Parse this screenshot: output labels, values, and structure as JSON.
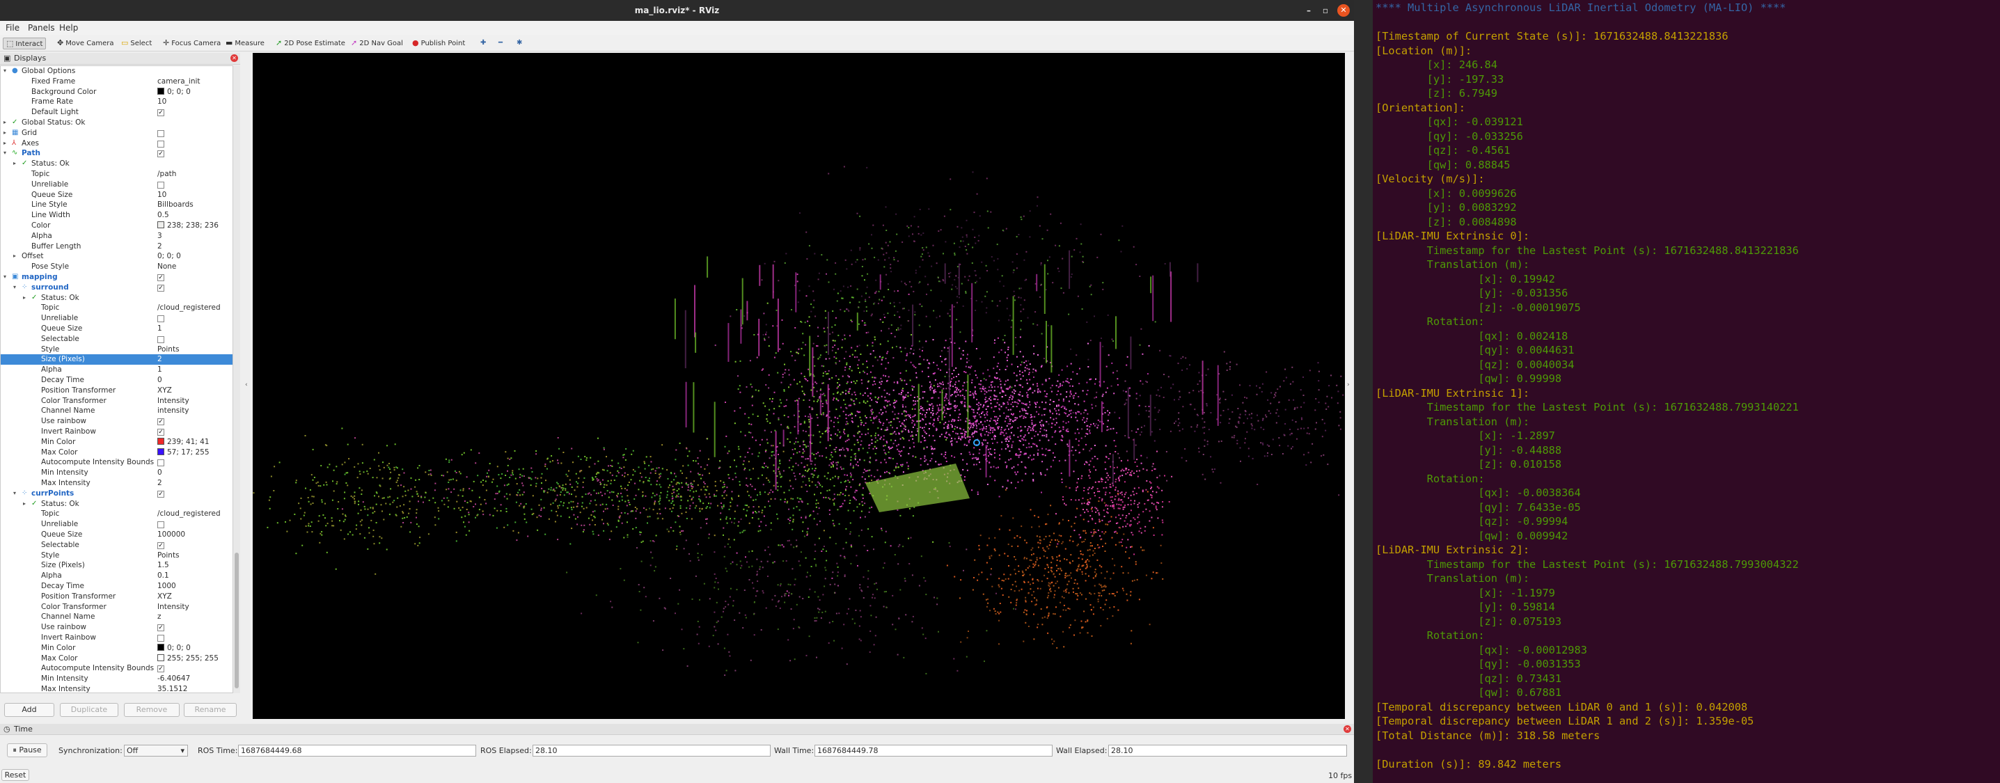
{
  "window": {
    "title": "ma_lio.rviz* - RViz"
  },
  "menu": [
    "File",
    "Panels",
    "Help"
  ],
  "toolbar": [
    "Interact",
    "Move Camera",
    "Select",
    "Focus Camera",
    "Measure",
    "2D Pose Estimate",
    "2D Nav Goal",
    "Publish Point"
  ],
  "displays": {
    "title": "Displays",
    "rows": [
      {
        "name": "Global Options",
        "value": "",
        "indent": 0,
        "exp": "open",
        "icon": "globe",
        "cls": ""
      },
      {
        "name": "Fixed Frame",
        "value": "camera_init",
        "indent": 2
      },
      {
        "name": "Background Color",
        "value": "0; 0; 0",
        "indent": 2,
        "swatch": "#000000"
      },
      {
        "name": "Frame Rate",
        "value": "10",
        "indent": 2
      },
      {
        "name": "Default Light",
        "value": "",
        "indent": 2,
        "check": "✓"
      },
      {
        "name": "Global Status: Ok",
        "value": "",
        "indent": 0,
        "exp": "closed",
        "icon": "ok"
      },
      {
        "name": "Grid",
        "value": "",
        "indent": 0,
        "exp": "closed",
        "icon": "grid",
        "check": ""
      },
      {
        "name": "Axes",
        "value": "",
        "indent": 0,
        "exp": "closed",
        "icon": "axes",
        "check": ""
      },
      {
        "name": "Path",
        "value": "",
        "indent": 0,
        "exp": "open",
        "icon": "path",
        "cls": "blue",
        "check": "✓"
      },
      {
        "name": "Status: Ok",
        "value": "",
        "indent": 1,
        "exp": "closed",
        "icon": "ok"
      },
      {
        "name": "Topic",
        "value": "/path",
        "indent": 2
      },
      {
        "name": "Unreliable",
        "value": "",
        "indent": 2,
        "check": ""
      },
      {
        "name": "Queue Size",
        "value": "10",
        "indent": 2
      },
      {
        "name": "Line Style",
        "value": "Billboards",
        "indent": 2
      },
      {
        "name": "Line Width",
        "value": "0.5",
        "indent": 2
      },
      {
        "name": "Color",
        "value": "238; 238; 236",
        "indent": 2,
        "swatch": "#eeeeec"
      },
      {
        "name": "Alpha",
        "value": "3",
        "indent": 2
      },
      {
        "name": "Buffer Length",
        "value": "2",
        "indent": 2
      },
      {
        "name": "Offset",
        "value": "0; 0; 0",
        "indent": 1,
        "exp": "closed"
      },
      {
        "name": "Pose Style",
        "value": "None",
        "indent": 2
      },
      {
        "name": "mapping",
        "value": "",
        "indent": 0,
        "exp": "open",
        "icon": "folder",
        "cls": "blue",
        "check": "✓"
      },
      {
        "name": "surround",
        "value": "",
        "indent": 1,
        "exp": "open",
        "icon": "cloud",
        "cls": "blue",
        "check": "✓"
      },
      {
        "name": "Status: Ok",
        "value": "",
        "indent": 2,
        "exp": "closed",
        "icon": "ok"
      },
      {
        "name": "Topic",
        "value": "/cloud_registered",
        "indent": 3
      },
      {
        "name": "Unreliable",
        "value": "",
        "indent": 3,
        "check": ""
      },
      {
        "name": "Queue Size",
        "value": "1",
        "indent": 3
      },
      {
        "name": "Selectable",
        "value": "",
        "indent": 3,
        "check": ""
      },
      {
        "name": "Style",
        "value": "Points",
        "indent": 3
      },
      {
        "name": "Size (Pixels)",
        "value": "2",
        "indent": 3,
        "selected": true
      },
      {
        "name": "Alpha",
        "value": "1",
        "indent": 3
      },
      {
        "name": "Decay Time",
        "value": "0",
        "indent": 3
      },
      {
        "name": "Position Transformer",
        "value": "XYZ",
        "indent": 3
      },
      {
        "name": "Color Transformer",
        "value": "Intensity",
        "indent": 3
      },
      {
        "name": "Channel Name",
        "value": "intensity",
        "indent": 3
      },
      {
        "name": "Use rainbow",
        "value": "",
        "indent": 3,
        "check": "✓"
      },
      {
        "name": "Invert Rainbow",
        "value": "",
        "indent": 3,
        "check": "✓"
      },
      {
        "name": "Min Color",
        "value": "239; 41; 41",
        "indent": 3,
        "swatch": "#ef2929"
      },
      {
        "name": "Max Color",
        "value": "57; 17; 255",
        "indent": 3,
        "swatch": "#3911ff"
      },
      {
        "name": "Autocompute Intensity Bounds",
        "value": "",
        "indent": 3,
        "check": ""
      },
      {
        "name": "Min Intensity",
        "value": "0",
        "indent": 3
      },
      {
        "name": "Max Intensity",
        "value": "2",
        "indent": 3
      },
      {
        "name": "currPoints",
        "value": "",
        "indent": 1,
        "exp": "open",
        "icon": "cloud",
        "cls": "blue",
        "check": "✓"
      },
      {
        "name": "Status: Ok",
        "value": "",
        "indent": 2,
        "exp": "closed",
        "icon": "ok"
      },
      {
        "name": "Topic",
        "value": "/cloud_registered",
        "indent": 3
      },
      {
        "name": "Unreliable",
        "value": "",
        "indent": 3,
        "check": ""
      },
      {
        "name": "Queue Size",
        "value": "100000",
        "indent": 3
      },
      {
        "name": "Selectable",
        "value": "",
        "indent": 3,
        "check": "✓"
      },
      {
        "name": "Style",
        "value": "Points",
        "indent": 3
      },
      {
        "name": "Size (Pixels)",
        "value": "1.5",
        "indent": 3
      },
      {
        "name": "Alpha",
        "value": "0.1",
        "indent": 3
      },
      {
        "name": "Decay Time",
        "value": "1000",
        "indent": 3
      },
      {
        "name": "Position Transformer",
        "value": "XYZ",
        "indent": 3
      },
      {
        "name": "Color Transformer",
        "value": "Intensity",
        "indent": 3
      },
      {
        "name": "Channel Name",
        "value": "z",
        "indent": 3
      },
      {
        "name": "Use rainbow",
        "value": "",
        "indent": 3,
        "check": "✓"
      },
      {
        "name": "Invert Rainbow",
        "value": "",
        "indent": 3,
        "check": ""
      },
      {
        "name": "Min Color",
        "value": "0; 0; 0",
        "indent": 3,
        "swatch": "#000000"
      },
      {
        "name": "Max Color",
        "value": "255; 255; 255",
        "indent": 3,
        "swatch": "#ffffff"
      },
      {
        "name": "Autocompute Intensity Bounds",
        "value": "",
        "indent": 3,
        "check": "✓"
      },
      {
        "name": "Min Intensity",
        "value": "-6.40647",
        "indent": 3
      },
      {
        "name": "Max Intensity",
        "value": "35.1512",
        "indent": 3
      }
    ],
    "buttons": [
      "Add",
      "Duplicate",
      "Remove",
      "Rename"
    ]
  },
  "time": {
    "title": "Time",
    "pause": "Pause",
    "sync_label": "Synchronization:",
    "sync_value": "Off",
    "ros_time_label": "ROS Time:",
    "ros_time": "1687684449.68",
    "ros_elapsed_label": "ROS Elapsed:",
    "ros_elapsed": "28.10",
    "wall_time_label": "Wall Time:",
    "wall_time": "1687684449.78",
    "wall_elapsed_label": "Wall Elapsed:",
    "wall_elapsed": "28.10",
    "reset": "Reset",
    "fps": "10 fps"
  },
  "terminal": {
    "lines": [
      {
        "t": "**** Multiple Asynchronous LiDAR Inertial Odometry (MA-LIO) ****",
        "c": "c"
      },
      {
        "t": "",
        "c": "g"
      },
      {
        "t": "[Timestamp of Current State (s)]: 1671632488.8413221836",
        "c": "y"
      },
      {
        "t": "[Location (m)]:",
        "c": "y"
      },
      {
        "t": "        [x]: 246.84",
        "c": "g"
      },
      {
        "t": "        [y]: -197.33",
        "c": "g"
      },
      {
        "t": "        [z]: 6.7949",
        "c": "g"
      },
      {
        "t": "[Orientation]:",
        "c": "y"
      },
      {
        "t": "        [qx]: -0.039121",
        "c": "g"
      },
      {
        "t": "        [qy]: -0.033256",
        "c": "g"
      },
      {
        "t": "        [qz]: -0.4561",
        "c": "g"
      },
      {
        "t": "        [qw]: 0.88845",
        "c": "g"
      },
      {
        "t": "[Velocity (m/s)]:",
        "c": "y"
      },
      {
        "t": "        [x]: 0.0099626",
        "c": "g"
      },
      {
        "t": "        [y]: 0.0083292",
        "c": "g"
      },
      {
        "t": "        [z]: 0.0084898",
        "c": "g"
      },
      {
        "t": "[LiDAR-IMU Extrinsic 0]:",
        "c": "y"
      },
      {
        "t": "        Timestamp for the Lastest Point (s): 1671632488.8413221836",
        "c": "g"
      },
      {
        "t": "        Translation (m):",
        "c": "g"
      },
      {
        "t": "                [x]: 0.19942",
        "c": "g"
      },
      {
        "t": "                [y]: -0.031356",
        "c": "g"
      },
      {
        "t": "                [z]: -0.00019075",
        "c": "g"
      },
      {
        "t": "        Rotation:",
        "c": "g"
      },
      {
        "t": "                [qx]: 0.002418",
        "c": "g"
      },
      {
        "t": "                [qy]: 0.0044631",
        "c": "g"
      },
      {
        "t": "                [qz]: 0.0040034",
        "c": "g"
      },
      {
        "t": "                [qw]: 0.99998",
        "c": "g"
      },
      {
        "t": "[LiDAR-IMU Extrinsic 1]:",
        "c": "y"
      },
      {
        "t": "        Timestamp for the Lastest Point (s): 1671632488.7993140221",
        "c": "g"
      },
      {
        "t": "        Translation (m):",
        "c": "g"
      },
      {
        "t": "                [x]: -1.2897",
        "c": "g"
      },
      {
        "t": "                [y]: -0.44888",
        "c": "g"
      },
      {
        "t": "                [z]: 0.010158",
        "c": "g"
      },
      {
        "t": "        Rotation:",
        "c": "g"
      },
      {
        "t": "                [qx]: -0.0038364",
        "c": "g"
      },
      {
        "t": "                [qy]: 7.6433e-05",
        "c": "g"
      },
      {
        "t": "                [qz]: -0.99994",
        "c": "g"
      },
      {
        "t": "                [qw]: 0.009942",
        "c": "g"
      },
      {
        "t": "[LiDAR-IMU Extrinsic 2]:",
        "c": "y"
      },
      {
        "t": "        Timestamp for the Lastest Point (s): 1671632488.7993004322",
        "c": "g"
      },
      {
        "t": "        Translation (m):",
        "c": "g"
      },
      {
        "t": "                [x]: -1.1979",
        "c": "g"
      },
      {
        "t": "                [y]: 0.59814",
        "c": "g"
      },
      {
        "t": "                [z]: 0.075193",
        "c": "g"
      },
      {
        "t": "        Rotation:",
        "c": "g"
      },
      {
        "t": "                [qx]: -0.00012983",
        "c": "g"
      },
      {
        "t": "                [qy]: -0.0031353",
        "c": "g"
      },
      {
        "t": "                [qz]: 0.73431",
        "c": "g"
      },
      {
        "t": "                [qw]: 0.67881",
        "c": "g"
      },
      {
        "t": "[Temporal discrepancy between LiDAR 0 and 1 (s)]: 0.042008",
        "c": "y"
      },
      {
        "t": "[Temporal discrepancy between LiDAR 1 and 2 (s)]: 1.359e-05",
        "c": "y"
      },
      {
        "t": "[Total Distance (m)]: 318.58 meters",
        "c": "y"
      },
      {
        "t": "",
        "c": "g"
      },
      {
        "t": "[Duration (s)]: 89.842 meters",
        "c": "y"
      }
    ]
  }
}
